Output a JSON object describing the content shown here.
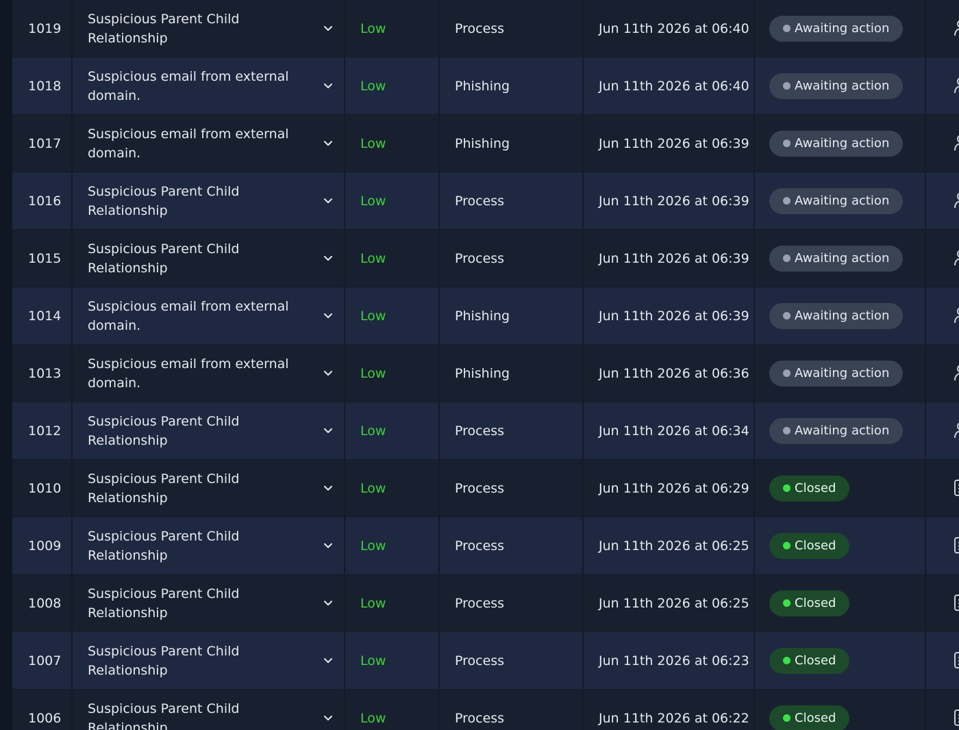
{
  "rows": [
    {
      "id": "1019",
      "title": "Suspicious Parent Child Relationship",
      "severity": "Low",
      "category": "Process",
      "date": "Jun 11th 2026 at 06:40",
      "status": "Awaiting action",
      "status_type": "awaiting",
      "action_icon": "user-icon"
    },
    {
      "id": "1018",
      "title": "Suspicious email from external domain.",
      "severity": "Low",
      "category": "Phishing",
      "date": "Jun 11th 2026 at 06:40",
      "status": "Awaiting action",
      "status_type": "awaiting",
      "action_icon": "user-icon"
    },
    {
      "id": "1017",
      "title": "Suspicious email from external domain.",
      "severity": "Low",
      "category": "Phishing",
      "date": "Jun 11th 2026 at 06:39",
      "status": "Awaiting action",
      "status_type": "awaiting",
      "action_icon": "user-icon"
    },
    {
      "id": "1016",
      "title": "Suspicious Parent Child Relationship",
      "severity": "Low",
      "category": "Process",
      "date": "Jun 11th 2026 at 06:39",
      "status": "Awaiting action",
      "status_type": "awaiting",
      "action_icon": "user-icon"
    },
    {
      "id": "1015",
      "title": "Suspicious Parent Child Relationship",
      "severity": "Low",
      "category": "Process",
      "date": "Jun 11th 2026 at 06:39",
      "status": "Awaiting action",
      "status_type": "awaiting",
      "action_icon": "user-icon"
    },
    {
      "id": "1014",
      "title": "Suspicious email from external domain.",
      "severity": "Low",
      "category": "Phishing",
      "date": "Jun 11th 2026 at 06:39",
      "status": "Awaiting action",
      "status_type": "awaiting",
      "action_icon": "user-icon"
    },
    {
      "id": "1013",
      "title": "Suspicious email from external domain.",
      "severity": "Low",
      "category": "Phishing",
      "date": "Jun 11th 2026 at 06:36",
      "status": "Awaiting action",
      "status_type": "awaiting",
      "action_icon": "user-icon"
    },
    {
      "id": "1012",
      "title": "Suspicious Parent Child Relationship",
      "severity": "Low",
      "category": "Process",
      "date": "Jun 11th 2026 at 06:34",
      "status": "Awaiting action",
      "status_type": "awaiting",
      "action_icon": "user-icon"
    },
    {
      "id": "1010",
      "title": "Suspicious Parent Child Relationship",
      "severity": "Low",
      "category": "Process",
      "date": "Jun 11th 2026 at 06:29",
      "status": "Closed",
      "status_type": "closed",
      "action_icon": "report-icon"
    },
    {
      "id": "1009",
      "title": "Suspicious Parent Child Relationship",
      "severity": "Low",
      "category": "Process",
      "date": "Jun 11th 2026 at 06:25",
      "status": "Closed",
      "status_type": "closed",
      "action_icon": "report-icon"
    },
    {
      "id": "1008",
      "title": "Suspicious Parent Child Relationship",
      "severity": "Low",
      "category": "Process",
      "date": "Jun 11th 2026 at 06:25",
      "status": "Closed",
      "status_type": "closed",
      "action_icon": "report-icon"
    },
    {
      "id": "1007",
      "title": "Suspicious Parent Child Relationship",
      "severity": "Low",
      "category": "Process",
      "date": "Jun 11th 2026 at 06:23",
      "status": "Closed",
      "status_type": "closed",
      "action_icon": "report-icon"
    },
    {
      "id": "1006",
      "title": "Suspicious Parent Child Relationship",
      "severity": "Low",
      "category": "Process",
      "date": "Jun 11th 2026 at 06:22",
      "status": "Closed",
      "status_type": "closed",
      "action_icon": "report-icon"
    }
  ],
  "colors": {
    "background": "#131a28",
    "row_dark": "#18202f",
    "row_light": "#1e2840",
    "severity_low": "#3dd13d",
    "badge_awaiting": "#3a4354",
    "badge_closed": "#1c4a2a",
    "dot_closed": "#3ee04a"
  }
}
